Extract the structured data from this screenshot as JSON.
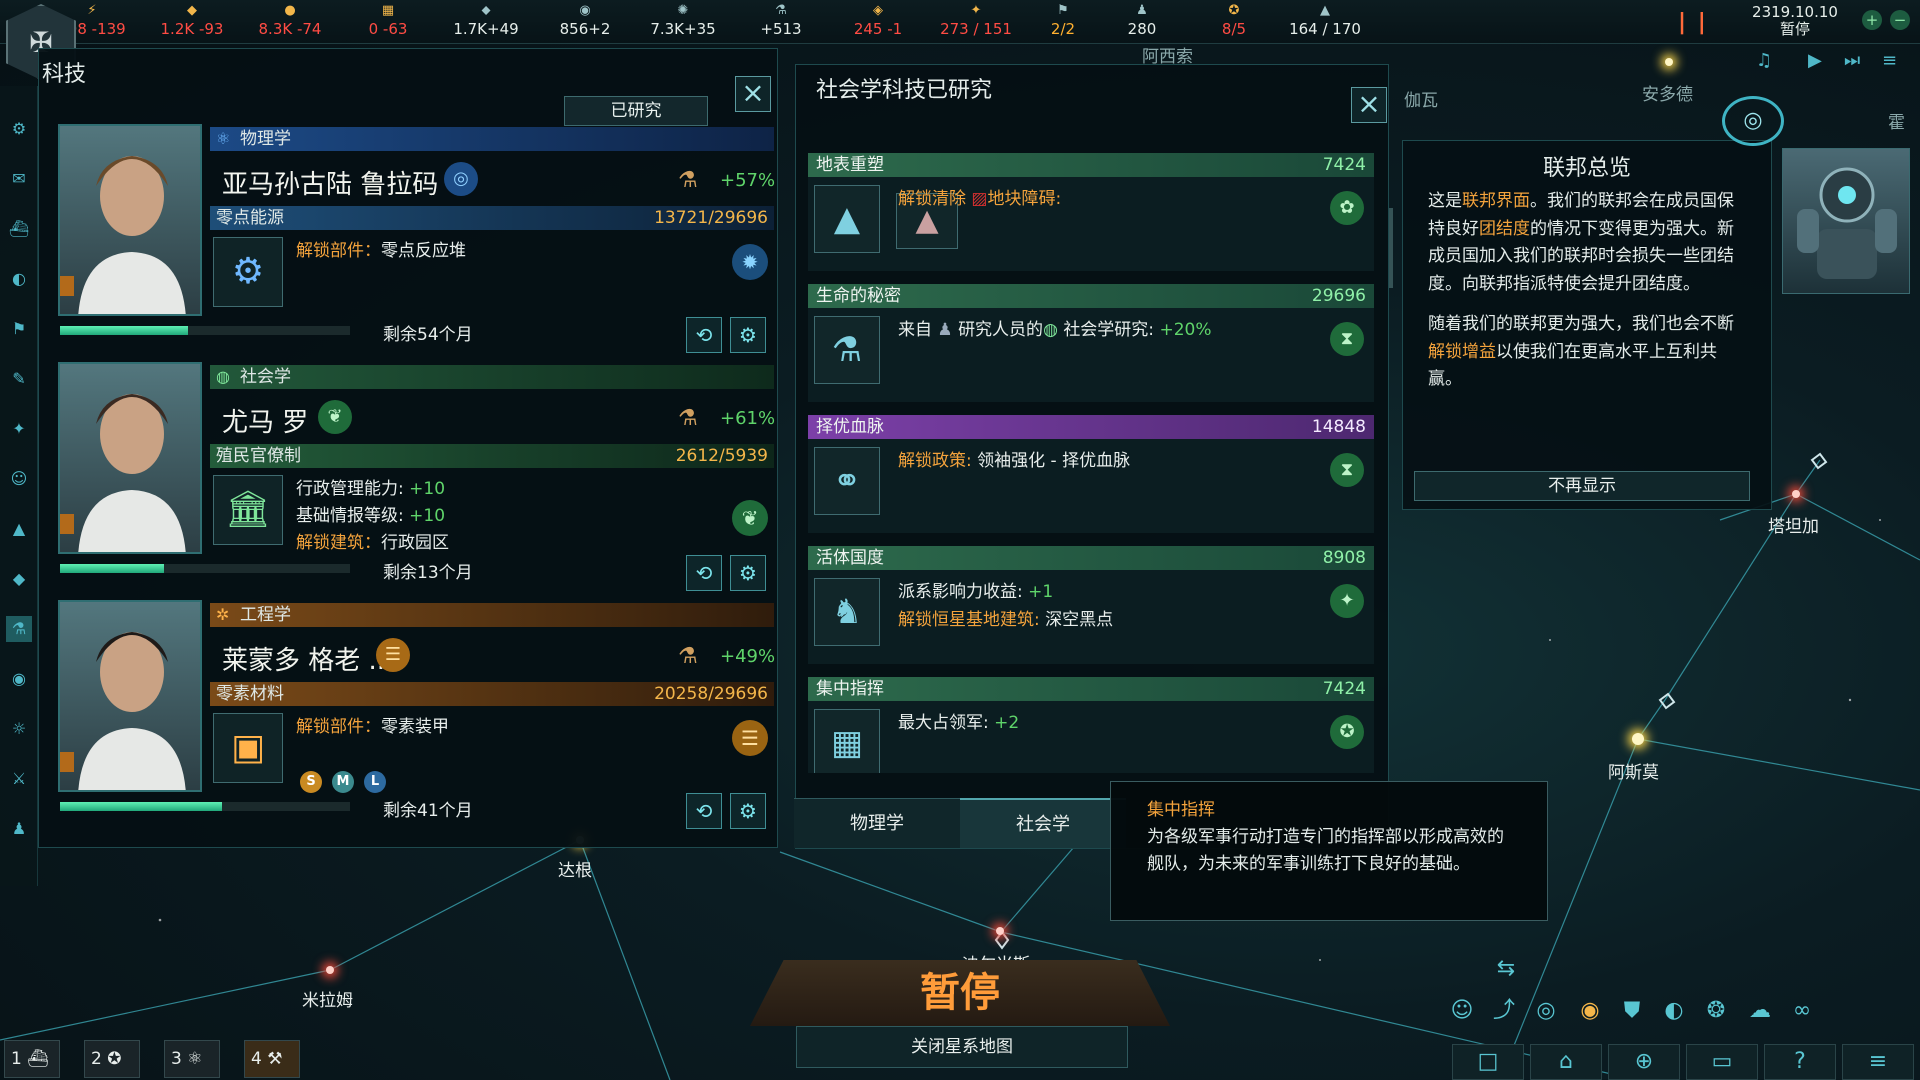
{
  "topbar": {
    "resources": [
      {
        "icon": "energy-icon",
        "glyph": "⚡",
        "value": "598 -139",
        "tone": "neg"
      },
      {
        "icon": "minerals-icon",
        "glyph": "◆",
        "value": "1.2K -93",
        "tone": "neg"
      },
      {
        "icon": "food-icon",
        "glyph": "●",
        "value": "8.3K -74",
        "tone": "neg"
      },
      {
        "icon": "consumer-goods-icon",
        "glyph": "▦",
        "value": "0 -63",
        "tone": "neg"
      },
      {
        "icon": "alloys-icon",
        "glyph": "⬥",
        "value": "1.7K+49",
        "tone": "pos"
      },
      {
        "icon": "influence-icon",
        "glyph": "◉",
        "value": "856+2",
        "tone": "pos"
      },
      {
        "icon": "unity-icon",
        "glyph": "✺",
        "value": "7.3K+35",
        "tone": "pos"
      },
      {
        "icon": "research-icon",
        "glyph": "⚗",
        "value": "+513",
        "tone": "pos"
      },
      {
        "icon": "amenities-icon",
        "glyph": "◈",
        "value": "245 -1",
        "tone": "neg"
      },
      {
        "icon": "naval-capacity-icon",
        "glyph": "✦",
        "value": "273 / 151",
        "tone": "neg"
      },
      {
        "icon": "starbase-icon",
        "glyph": "⚑",
        "value": "2/2",
        "tone": "warn"
      },
      {
        "icon": "pops-icon",
        "glyph": "♟",
        "value": "280",
        "tone": "pos"
      },
      {
        "icon": "leader-icon",
        "glyph": "✪",
        "value": "8/5",
        "tone": "neg"
      },
      {
        "icon": "empire-size-icon",
        "glyph": "▲",
        "value": "164 / 170",
        "tone": "pos"
      }
    ],
    "date": "2319.10.10",
    "status": "暂停"
  },
  "tech": {
    "title": "科技",
    "researched_btn": "已研究",
    "slots": [
      {
        "category": "物理学",
        "category_icon": "⚛",
        "scientist": "亚马孙古陆 鲁拉码",
        "trait_glyph": "◎",
        "bonus": "+57%",
        "project": "零点能源",
        "progress": "13721/29696",
        "fraction": 0.462,
        "desc": [
          {
            "lab": "解锁部件：",
            "val": "零点反应堆"
          }
        ],
        "remaining": "剩余54个月",
        "bar": 0.44
      },
      {
        "category": "社会学",
        "category_icon": "◍",
        "scientist": "尤马 罗",
        "trait_glyph": "❦",
        "bonus": "+61%",
        "project": "殖民官僚制",
        "progress": "2612/5939",
        "fraction": 0.44,
        "desc": [
          {
            "lab": "行政管理能力:",
            "val": " +10",
            "green": true
          },
          {
            "lab": "基础情报等级:",
            "val": " +10",
            "green": true
          },
          {
            "lab": "解锁建筑：",
            "val": "行政园区",
            "or": true
          }
        ],
        "remaining": "剩余13个月",
        "bar": 0.36
      },
      {
        "category": "工程学",
        "category_icon": "✲",
        "scientist": "莱蒙多 格老 ...",
        "trait_glyph": "☰",
        "bonus": "+49%",
        "project": "零素材料",
        "progress": "20258/29696",
        "fraction": 0.682,
        "desc": [
          {
            "lab": "解锁部件：",
            "val": "零素装甲"
          }
        ],
        "sizes": [
          "S",
          "M",
          "L"
        ],
        "remaining": "剩余41个月",
        "bar": 0.56
      }
    ]
  },
  "soc": {
    "title": "社会学科技已研究",
    "cards": [
      {
        "name": "地表重塑",
        "cost": "7424",
        "lines": [
          {
            "a": "解锁清除",
            "b": "地块障碍:",
            "mode": "orange"
          }
        ]
      },
      {
        "name": "生命的秘密",
        "cost": "29696",
        "lines": [
          {
            "a": "来自",
            "b": "研究人员的",
            "c": "社会学研究:",
            "d": " +20%",
            "mode": "mixed"
          }
        ]
      },
      {
        "name": "择优血脉",
        "cost": "14848",
        "purple": true,
        "lines": [
          {
            "a": "解锁政策:",
            "b": " 领袖强化 - 择优血脉",
            "mode": "policy"
          }
        ]
      },
      {
        "name": "活体国度",
        "cost": "8908",
        "lines": [
          {
            "a": "派系影响力收益:",
            "b": " +1",
            "mode": "green"
          },
          {
            "a": "解锁恒星基地建筑:",
            "b": " 深空黑点",
            "mode": "policy"
          }
        ]
      },
      {
        "name": "集中指挥",
        "cost": "7424",
        "lines": [
          {
            "a": "最大占领军:",
            "b": " +2",
            "mode": "green"
          }
        ]
      }
    ],
    "tabs": [
      "物理学",
      "社会学"
    ]
  },
  "tooltip": {
    "title": "集中指挥",
    "body": "为各级军事行动打造专门的指挥部以形成高效的舰队，为未来的军事训练打下良好的基础。"
  },
  "federation": {
    "title": "联邦总览",
    "p1": [
      "这是",
      "联邦界面",
      "。我们的联邦会在成员国保持良好",
      "团结度",
      "的情况下变得更为强大。新成员国加入我们的联邦时会损失一些团结度。向联邦指派特使会提升团结度。"
    ],
    "p2": [
      "随着我们的联邦更为强大，我们也会不断",
      "解锁增益",
      "以使我们在更高水平上互利共赢。"
    ],
    "dismiss": "不再显示"
  },
  "map": {
    "systems": [
      "达根",
      "米拉姆",
      "迪尔米斯",
      "阿斯莫",
      "塔坦加",
      "安多德",
      "伽瓦",
      "阿西索",
      "霍"
    ],
    "pause_banner": "暂停",
    "close_map": "关闭星系地图",
    "groups": [
      "1",
      "2",
      "3",
      "4"
    ]
  }
}
